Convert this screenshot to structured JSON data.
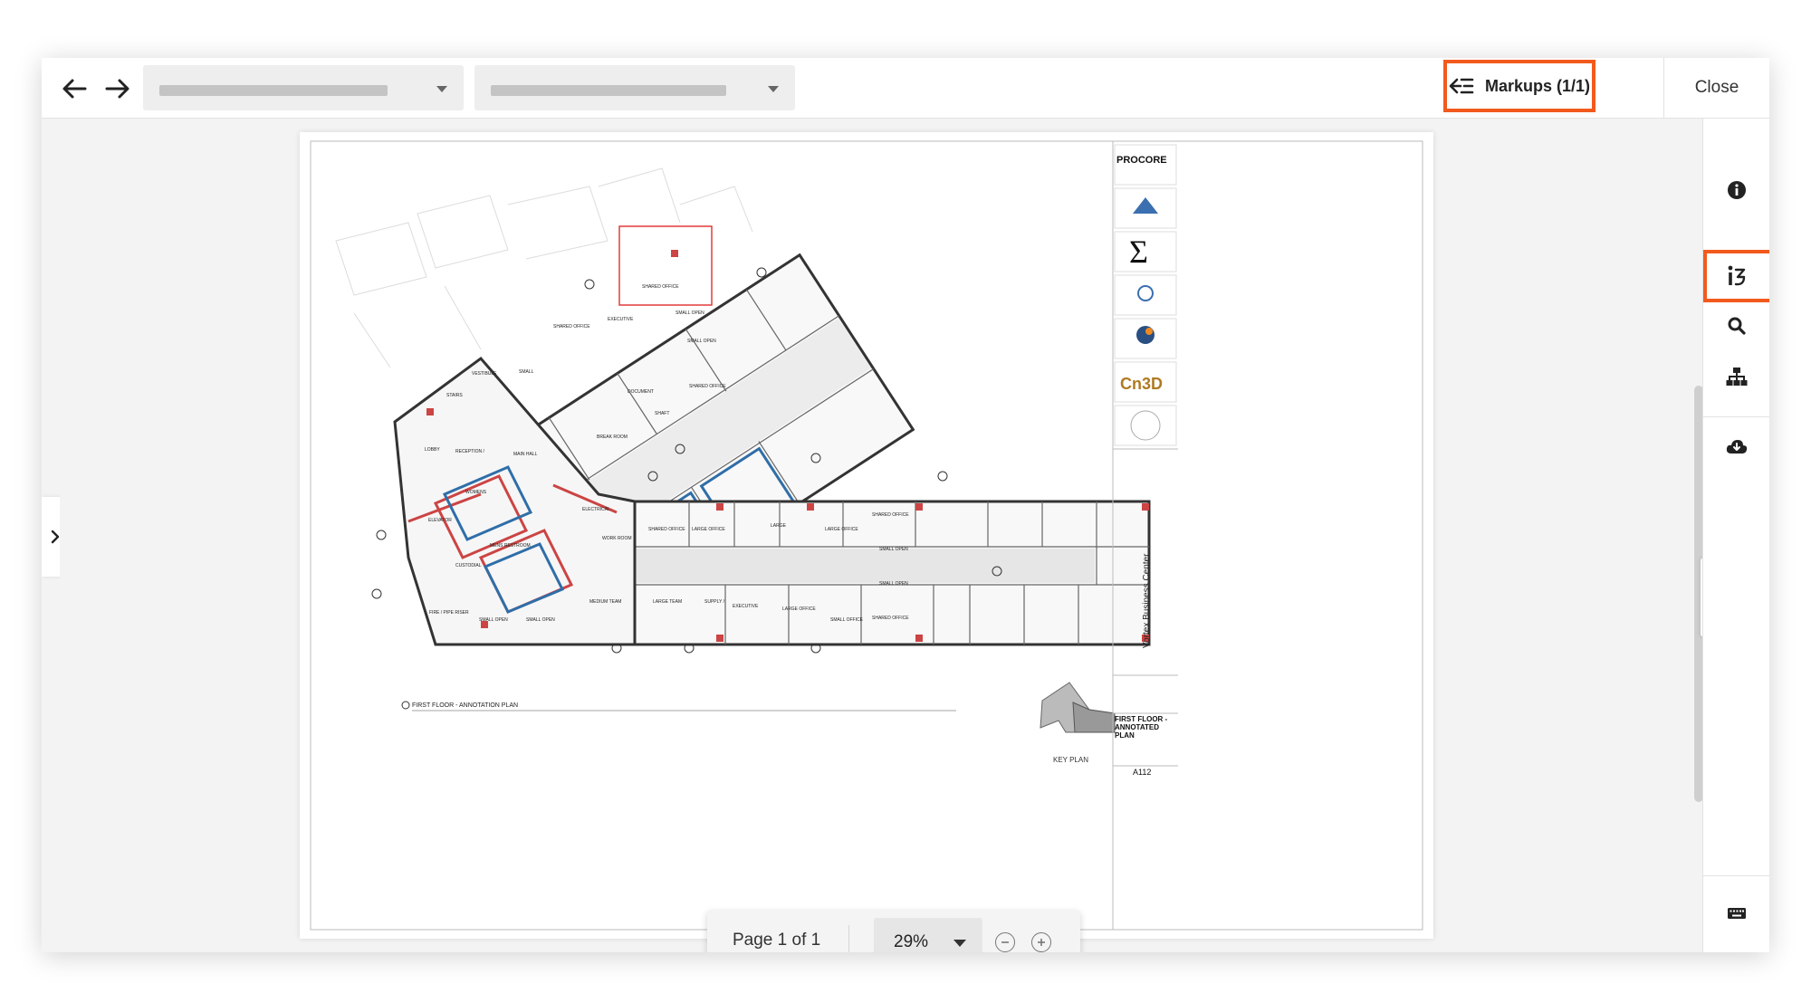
{
  "topbar": {
    "markups_label": "Markups (1/1)",
    "close_label": "Close"
  },
  "colors": {
    "highlight": "#f25a1d",
    "markup_rect": "#e23b3b"
  },
  "page_controls": {
    "page_label": "Page 1 of 1",
    "zoom_value": "29%"
  },
  "drawing": {
    "company_logo": "PROCORE",
    "contractor_logo": "Cn3D",
    "project_name": "Vortex Business Center",
    "sheet_name": "FIRST FLOOR - ANNOTATED PLAN",
    "sheet_number": "A112",
    "view_title": "FIRST FLOOR - ANNOTATION PLAN",
    "key_plan_label": "KEY PLAN",
    "rooms": [
      "SHARED OFFICE",
      "EXECUTIVE OFFICE",
      "SMALL OPEN OFFICE",
      "SHARED OFFICE",
      "SMALL CONFERENCE",
      "VESTIBULE",
      "STAIRS",
      "DOCUMENT STORAGE",
      "SHAFT",
      "HALL",
      "BREAK ROOM",
      "MAIN HALL",
      "LOBBY",
      "RECEPTION / SECURITY",
      "WOMENS RESTROOM",
      "ELEVATOR",
      "ELECTRICAL",
      "WORK ROOM",
      "MENS RESTROOM",
      "CUSTODIAL",
      "SHARED OFFICE",
      "LARGE OFFICE",
      "LARGE CONFERENCE",
      "MEDIUM TEAM OPEN",
      "LARGE TEAM AREA",
      "SUPPLY / STORAGE",
      "EXECUTIVE OFFICE",
      "SMALL OFFICE",
      "FIRE / PIPE RISER"
    ]
  },
  "rail": {
    "info_icon": "info-icon",
    "markups_icon": "markups-panel-icon",
    "search_icon": "search-icon",
    "hierarchy_icon": "hierarchy-icon",
    "download_icon": "cloud-download-icon",
    "keyboard_icon": "keyboard-icon"
  }
}
